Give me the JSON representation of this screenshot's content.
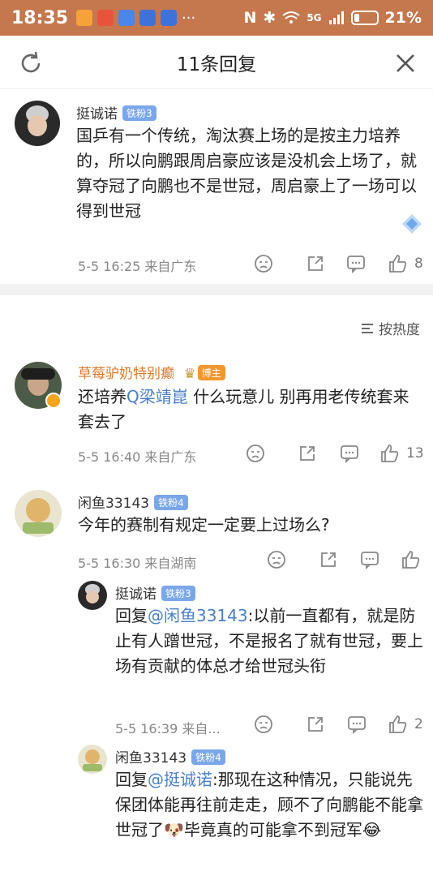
{
  "status_bar": {
    "time": "18:35",
    "ellipsis": "···",
    "network": "5G",
    "battery": "21%"
  },
  "header": {
    "title": "11条回复"
  },
  "main_comment": {
    "user": "挺诚诺",
    "badge": "铁粉3",
    "text": "国乒有一个传统，淘汰赛上场的是按主力培养的，所以向鹏跟周启豪应该是没机会上场了，就算夺冠了向鹏也不是世冠，周启豪上了一场可以得到世冠",
    "meta": "5-5 16:25 来自广东",
    "likes": "8"
  },
  "sort": {
    "label": "按热度"
  },
  "replies": [
    {
      "user": "草莓驴奶特别癫",
      "badge": "博主",
      "text_parts": [
        "还培养",
        "Q梁靖崑",
        " 什么玩意儿 别再用老传统套来套去了"
      ],
      "meta": "5-5 16:40 来自广东",
      "likes": "13"
    },
    {
      "user": "闲鱼33143",
      "badge": "铁粉4",
      "text": "今年的赛制有规定一定要上过场么?",
      "meta": "5-5 16:30 来自湖南"
    },
    {
      "user": "挺诚诺",
      "badge": "铁粉3",
      "text_parts": [
        "回复",
        "@闲鱼33143",
        ":以前一直都有，就是防止有人蹭世冠，不是报名了就有世冠，要上场有贡献的体总才给世冠头衔"
      ],
      "meta": "5-5 16:39 来自...",
      "likes": "2"
    },
    {
      "user": "闲鱼33143",
      "badge": "铁粉4",
      "text_parts": [
        "回复",
        "@挺诚诺",
        ":那现在这种情况，只能说先保团体能再往前走走，顾不了向鹏能不能拿世冠了",
        "🐶",
        "毕竟真的可能拿不到冠军",
        "😂"
      ]
    }
  ]
}
